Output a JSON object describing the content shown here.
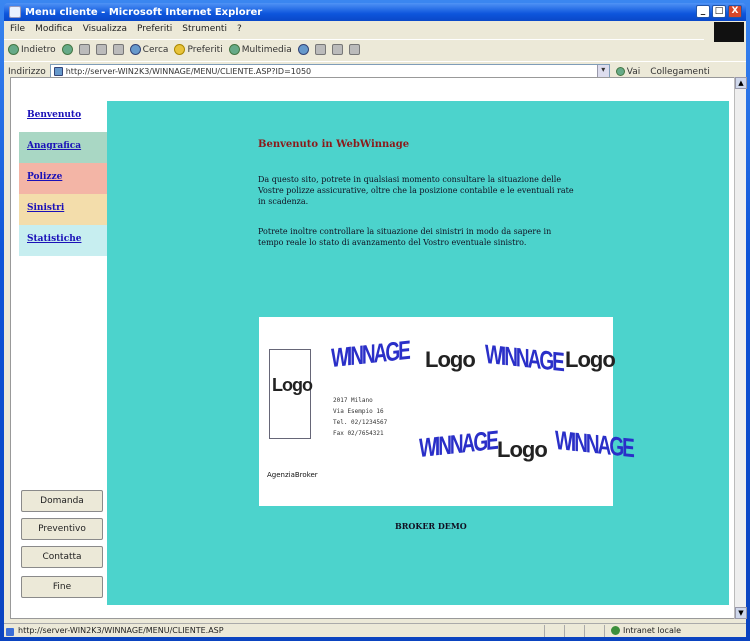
{
  "window": {
    "title": "Menu cliente - Microsoft Internet Explorer",
    "minimize": "_",
    "maximize": "□",
    "close": "X"
  },
  "menubar": {
    "items": [
      "File",
      "Modifica",
      "Visualizza",
      "Preferiti",
      "Strumenti",
      "?"
    ]
  },
  "toolbar": {
    "back": "Indietro",
    "search": "Cerca",
    "favorites": "Preferiti",
    "media": "Multimedia"
  },
  "addressbar": {
    "label": "Indirizzo",
    "url": "http://server-WIN2K3/WINNAGE/MENU/CLIENTE.ASP?ID=1050",
    "go": "Vai",
    "links": "Collegamenti"
  },
  "sidebar": {
    "items": [
      {
        "label": "Benvenuto",
        "bg": "#ffffff"
      },
      {
        "label": "Anagrafica",
        "bg": "#a9d7c4"
      },
      {
        "label": "Polizze",
        "bg": "#f3b5a6"
      },
      {
        "label": "Sinistri",
        "bg": "#f3ddab"
      },
      {
        "label": "Statistiche",
        "bg": "#c7eef0"
      }
    ],
    "buttons": [
      "Domanda",
      "Preventivo",
      "Contatta",
      "Fine"
    ]
  },
  "content": {
    "title": "Benvenuto in WebWinnage",
    "para1": "Da questo sito, potrete in qualsiasi momento consultare la situazione delle Vostre polizze assicurative, oltre che la posizione contabile e le eventuali rate in scadenza.",
    "para2": "Potrete inoltre controllare la situazione dei sinistri in modo da sapere in tempo reale lo stato di avanzamento del Vostro eventuale sinistro.",
    "footer": "BROKER DEMO",
    "logos": {
      "logo_word": "Logo",
      "brand_word": "WINNAGE",
      "agency": "AgenziaBroker",
      "contact": [
        "2017 Milano",
        "Via Esempio 16",
        "Tel. 02/1234567",
        "Fax 02/7654321"
      ]
    }
  },
  "statusbar": {
    "url": "http://server-WIN2K3/WINNAGE/MENU/CLIENTE.ASP",
    "zone": "Intranet locale"
  },
  "colors": {
    "content_bg": "#4cd3cc",
    "title_color": "#8b1a1a",
    "link_color": "#1a10b8",
    "xp_blue": "#0e54d8"
  }
}
